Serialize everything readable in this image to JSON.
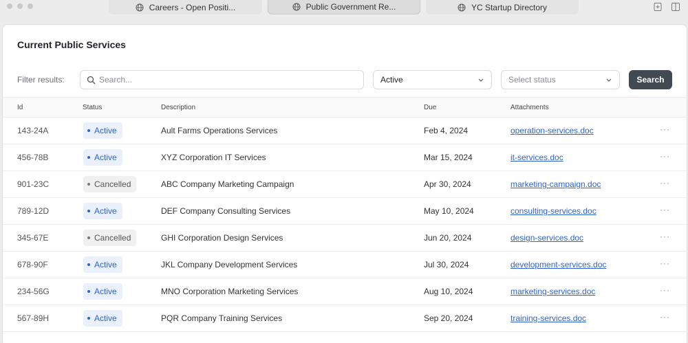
{
  "browser": {
    "tabs": [
      {
        "label": "Careers - Open Positi..."
      },
      {
        "label": "Public Government Re..."
      },
      {
        "label": "YC Startup Directory"
      }
    ],
    "icons": [
      "globe-icon",
      "new-tab-icon",
      "sidebar-icon"
    ]
  },
  "page": {
    "title": "Current Public Services"
  },
  "filters": {
    "label": "Filter results:",
    "search_placeholder": "Search...",
    "status_value": "Active",
    "status2_placeholder": "Select status",
    "search_button": "Search"
  },
  "table": {
    "headers": [
      "Id",
      "Status",
      "Description",
      "Due",
      "Attachments"
    ],
    "rows": [
      {
        "id": "143-24A",
        "status": "Active",
        "description": "Ault Farms Operations Services",
        "due": "Feb 4, 2024",
        "attachment": "operation-services.doc"
      },
      {
        "id": "456-78B",
        "status": "Active",
        "description": "XYZ Corporation IT Services",
        "due": "Mar 15, 2024",
        "attachment": "it-services.doc"
      },
      {
        "id": "901-23C",
        "status": "Cancelled",
        "description": "ABC Company Marketing Campaign",
        "due": "Apr 30, 2024",
        "attachment": "marketing-campaign.doc"
      },
      {
        "id": "789-12D",
        "status": "Active",
        "description": "DEF Company Consulting Services",
        "due": "May 10, 2024",
        "attachment": "consulting-services.doc"
      },
      {
        "id": "345-67E",
        "status": "Cancelled",
        "description": "GHI Corporation Design Services",
        "due": "Jun 20, 2024",
        "attachment": "design-services.doc"
      },
      {
        "id": "678-90F",
        "status": "Active",
        "description": "JKL Company Development Services",
        "due": "Jul 30, 2024",
        "attachment": "development-services.doc"
      },
      {
        "id": "234-56G",
        "status": "Active",
        "description": "MNO Corporation Marketing Services",
        "due": "Aug 10, 2024",
        "attachment": "marketing-services.doc"
      },
      {
        "id": "567-89H",
        "status": "Active",
        "description": "PQR Company Training Services",
        "due": "Sep 20, 2024",
        "attachment": "training-services.doc"
      }
    ],
    "more_label": "···"
  },
  "colors": {
    "accent": "#2f63c9",
    "button": "#414a52"
  }
}
